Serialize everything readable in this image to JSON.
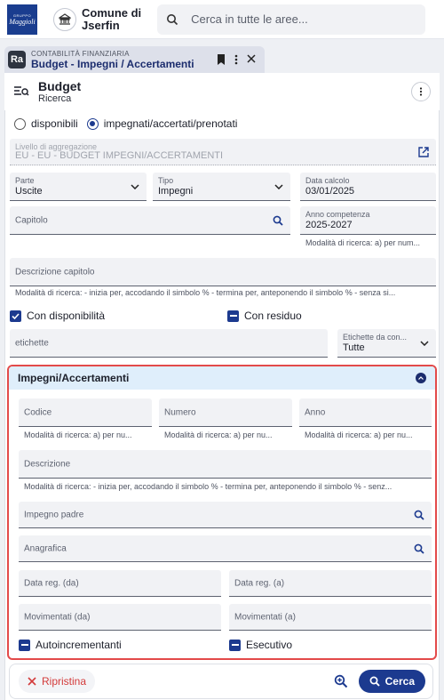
{
  "header": {
    "logo_top": "GRUPPO",
    "logo_brand": "Maggioli",
    "municipality_line1": "Comune di",
    "municipality_line2": "Jserfin",
    "search_placeholder": "Cerca in tutte le aree..."
  },
  "tab": {
    "badge": "Ra",
    "subtitle": "CONTABILITÀ FINANZIARIA",
    "title": "Budget - Impegni / Accertamenti"
  },
  "page": {
    "title": "Budget",
    "subtitle": "Ricerca"
  },
  "form": {
    "radio_options": [
      {
        "label": "disponibili",
        "selected": false
      },
      {
        "label": "impegnati/accertati/prenotati",
        "selected": true
      }
    ],
    "livello": {
      "label": "Livello di aggregazione",
      "value": "EU - EU - BUDGET IMPEGNI/ACCERTAMENTI"
    },
    "parte": {
      "label": "Parte",
      "value": "Uscite"
    },
    "tipo": {
      "label": "Tipo",
      "value": "Impegni"
    },
    "data_calcolo": {
      "label": "Data calcolo",
      "value": "03/01/2025"
    },
    "capitolo": {
      "label": "Capitolo"
    },
    "anno_competenza": {
      "label": "Anno competenza",
      "value": "2025-2027",
      "hint": "Modalità di ricerca: a) per num..."
    },
    "descrizione_capitolo": {
      "label": "Descrizione capitolo",
      "hint": "Modalità di ricerca: - inizia per, accodando il simbolo % - termina per, anteponendo il simbolo % - senza si..."
    },
    "con_disponibilita": "Con disponibilità",
    "con_residuo": "Con residuo",
    "etichette": {
      "label": "etichette"
    },
    "etichette_da": {
      "label": "Etichette da con...",
      "value": "Tutte"
    }
  },
  "section": {
    "title": "Impegni/Accertamenti",
    "codice": {
      "label": "Codice",
      "hint": "Modalità di ricerca: a) per nu..."
    },
    "numero": {
      "label": "Numero",
      "hint": "Modalità di ricerca: a) per nu..."
    },
    "anno": {
      "label": "Anno",
      "hint": "Modalità di ricerca: a) per nu..."
    },
    "descrizione": {
      "label": "Descrizione",
      "hint": "Modalità di ricerca: - inizia per, accodando il simbolo % - termina per, anteponendo il simbolo % - senz..."
    },
    "impegno_padre": {
      "label": "Impegno padre"
    },
    "anagrafica": {
      "label": "Anagrafica"
    },
    "data_reg_da": {
      "label": "Data reg. (da)"
    },
    "data_reg_a": {
      "label": "Data reg. (a)"
    },
    "movimentati_da": {
      "label": "Movimentati (da)"
    },
    "movimentati_a": {
      "label": "Movimentati (a)"
    },
    "autoincrementanti": "Autoincrementanti",
    "esecutivo": "Esecutivo"
  },
  "actions": {
    "reset": "Ripristina",
    "search": "Cerca"
  },
  "colors": {
    "primary": "#1c3a8f",
    "danger": "#d33a3a",
    "section_border": "#e34a4a",
    "section_head": "#dfeefb"
  }
}
